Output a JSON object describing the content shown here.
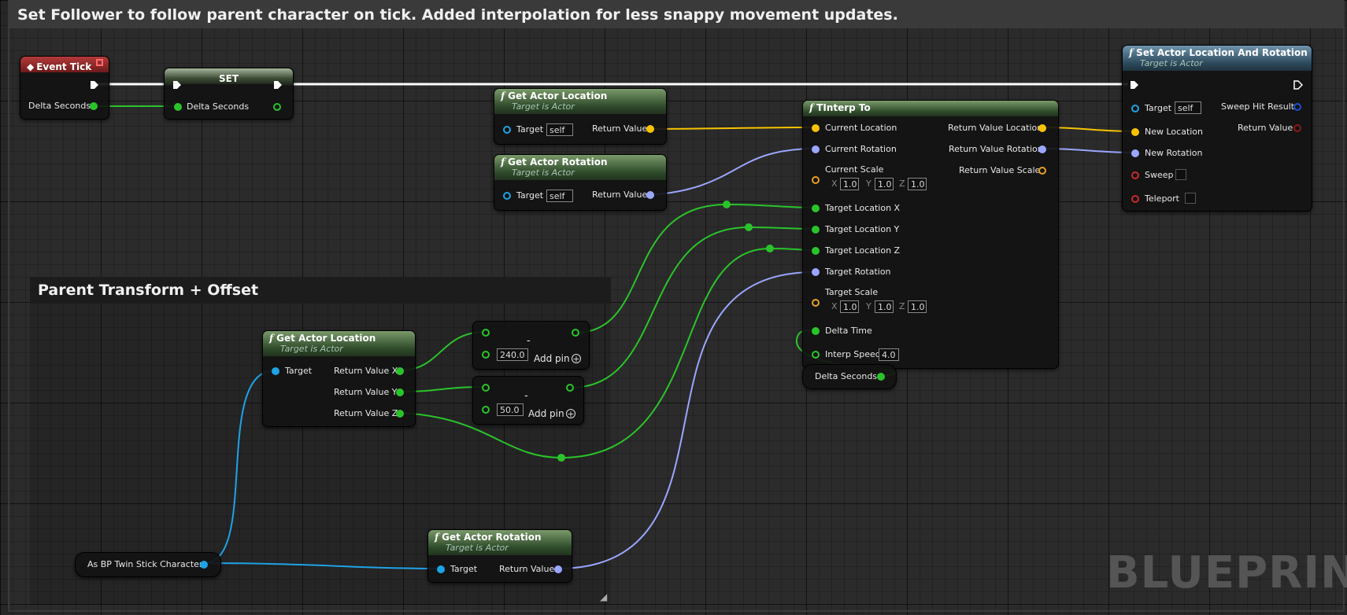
{
  "graph": {
    "main_comment": "Set Follower to follow parent character on tick. Added interpolation for less snappy movement updates.",
    "inner_comment": "Parent Transform + Offset",
    "watermark": "BLUEPRINT",
    "resize_glyph": "◢"
  },
  "event_tick": {
    "title": "Event Tick",
    "delta_seconds": "Delta Seconds"
  },
  "set_node": {
    "title": "SET",
    "delta_seconds": "Delta Seconds"
  },
  "get_location_top": {
    "title": "Get Actor Location",
    "subtitle": "Target is Actor",
    "target": "Target",
    "target_value": "self",
    "return": "Return Value"
  },
  "get_rotation_top": {
    "title": "Get Actor Rotation",
    "subtitle": "Target is Actor",
    "target": "Target",
    "target_value": "self",
    "return": "Return Value"
  },
  "tinterp": {
    "title": "TInterp To",
    "current_location": "Current Location",
    "current_rotation": "Current Rotation",
    "current_scale": "Current Scale",
    "current_scale_x": "1.0",
    "current_scale_y": "1.0",
    "current_scale_z": "1.0",
    "target_location_x": "Target Location X",
    "target_location_y": "Target Location Y",
    "target_location_z": "Target Location Z",
    "target_rotation": "Target Rotation",
    "target_scale": "Target Scale",
    "target_scale_x": "1.0",
    "target_scale_y": "1.0",
    "target_scale_z": "1.0",
    "delta_time": "Delta Time",
    "interp_speed": "Interp Speed",
    "interp_speed_value": "4.0",
    "ret_location": "Return Value Location",
    "ret_rotation": "Return Value Rotation",
    "ret_scale": "Return Value Scale",
    "axis_x": "X",
    "axis_y": "Y",
    "axis_z": "Z"
  },
  "set_actor": {
    "title": "Set Actor Location And Rotation",
    "subtitle": "Target is Actor",
    "target": "Target",
    "target_value": "self",
    "new_location": "New Location",
    "new_rotation": "New Rotation",
    "sweep": "Sweep",
    "teleport": "Teleport",
    "sweep_hit_result": "Sweep Hit Result",
    "return": "Return Value"
  },
  "delta_var": {
    "label": "Delta Seconds"
  },
  "get_location_bottom": {
    "title": "Get Actor Location",
    "subtitle": "Target is Actor",
    "target": "Target",
    "ret_x": "Return Value X",
    "ret_y": "Return Value Y",
    "ret_z": "Return Value Z"
  },
  "subtract_x": {
    "symbol": "-",
    "value": "240.0",
    "add_pin": "Add pin",
    "plus": "+"
  },
  "subtract_y": {
    "symbol": "-",
    "value": "50.0",
    "add_pin": "Add pin",
    "plus": "+"
  },
  "cast_node": {
    "label": "As BP Twin Stick Character"
  },
  "get_rotation_bottom": {
    "title": "Get Actor Rotation",
    "subtitle": "Target is Actor",
    "target": "Target",
    "return": "Return Value"
  },
  "colors": {
    "exec": "#ffffff",
    "float": "#2ac42a",
    "vector": "#f7c300",
    "rotator": "#9aa6ff",
    "object": "#1ea3e6"
  }
}
